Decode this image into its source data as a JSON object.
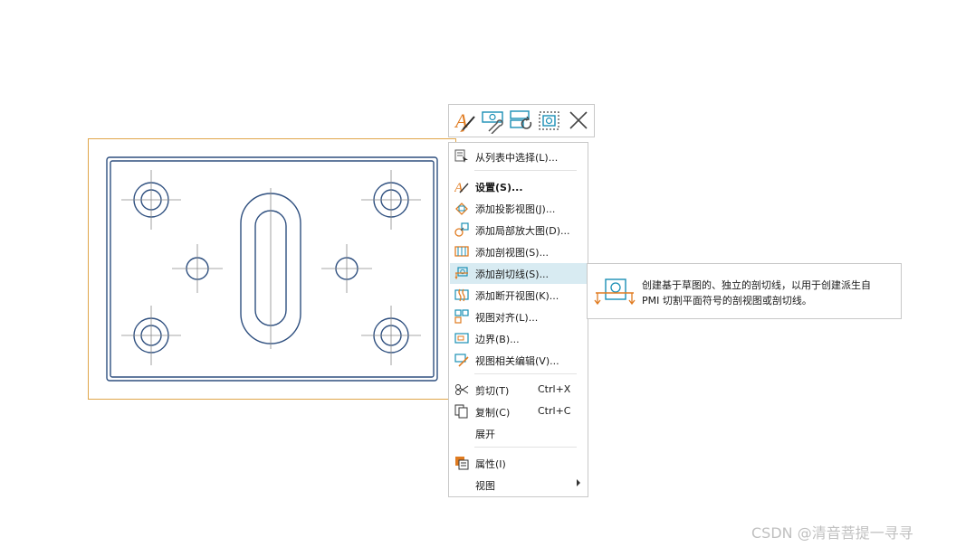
{
  "toolbar": {
    "buttons": [
      {
        "icon": "style-settings-icon"
      },
      {
        "icon": "edit-view-settings-icon"
      },
      {
        "icon": "update-view-icon"
      },
      {
        "icon": "view-boundary-icon"
      },
      {
        "icon": "close-icon"
      }
    ]
  },
  "menu": {
    "items": [
      {
        "label": "从列表中选择(L)...",
        "icon": "select-from-list-icon"
      },
      {
        "label": "设置(S)...",
        "icon": "settings-icon",
        "bold": true
      },
      {
        "label": "添加投影视图(J)...",
        "icon": "projected-view-icon"
      },
      {
        "label": "添加局部放大图(D)...",
        "icon": "detail-view-icon"
      },
      {
        "label": "添加剖视图(S)...",
        "icon": "section-view-icon"
      },
      {
        "label": "添加剖切线(S)...",
        "icon": "section-line-icon",
        "highlighted": true
      },
      {
        "label": "添加断开视图(K)...",
        "icon": "break-view-icon"
      },
      {
        "label": "视图对齐(L)...",
        "icon": "view-align-icon"
      },
      {
        "label": "边界(B)...",
        "icon": "boundary-icon"
      },
      {
        "label": "视图相关编辑(V)...",
        "icon": "view-dependent-edit-icon"
      },
      {
        "label": "剪切(T)",
        "icon": "cut-icon",
        "shortcut": "Ctrl+X"
      },
      {
        "label": "复制(C)",
        "icon": "copy-icon",
        "shortcut": "Ctrl+C"
      },
      {
        "label": "展开",
        "icon": ""
      },
      {
        "label": "属性(I)",
        "icon": "properties-icon"
      },
      {
        "label": "视图",
        "icon": "",
        "submenu": true
      }
    ]
  },
  "tooltip": {
    "line1": "创建基于草图的、独立的剖切线，以用于创建派生自",
    "line2": "PMI 切割平面符号的剖视图或剖切线。",
    "icon": "section-line-icon"
  },
  "watermark": "CSDN @清音菩提一寻寻",
  "colors": {
    "drawing_line": "#2e4f7f",
    "view_border": "#e0a64a",
    "menu_highlight": "#d8ebf2",
    "icon_orange": "#e07b20",
    "icon_teal": "#1a8fb5"
  }
}
